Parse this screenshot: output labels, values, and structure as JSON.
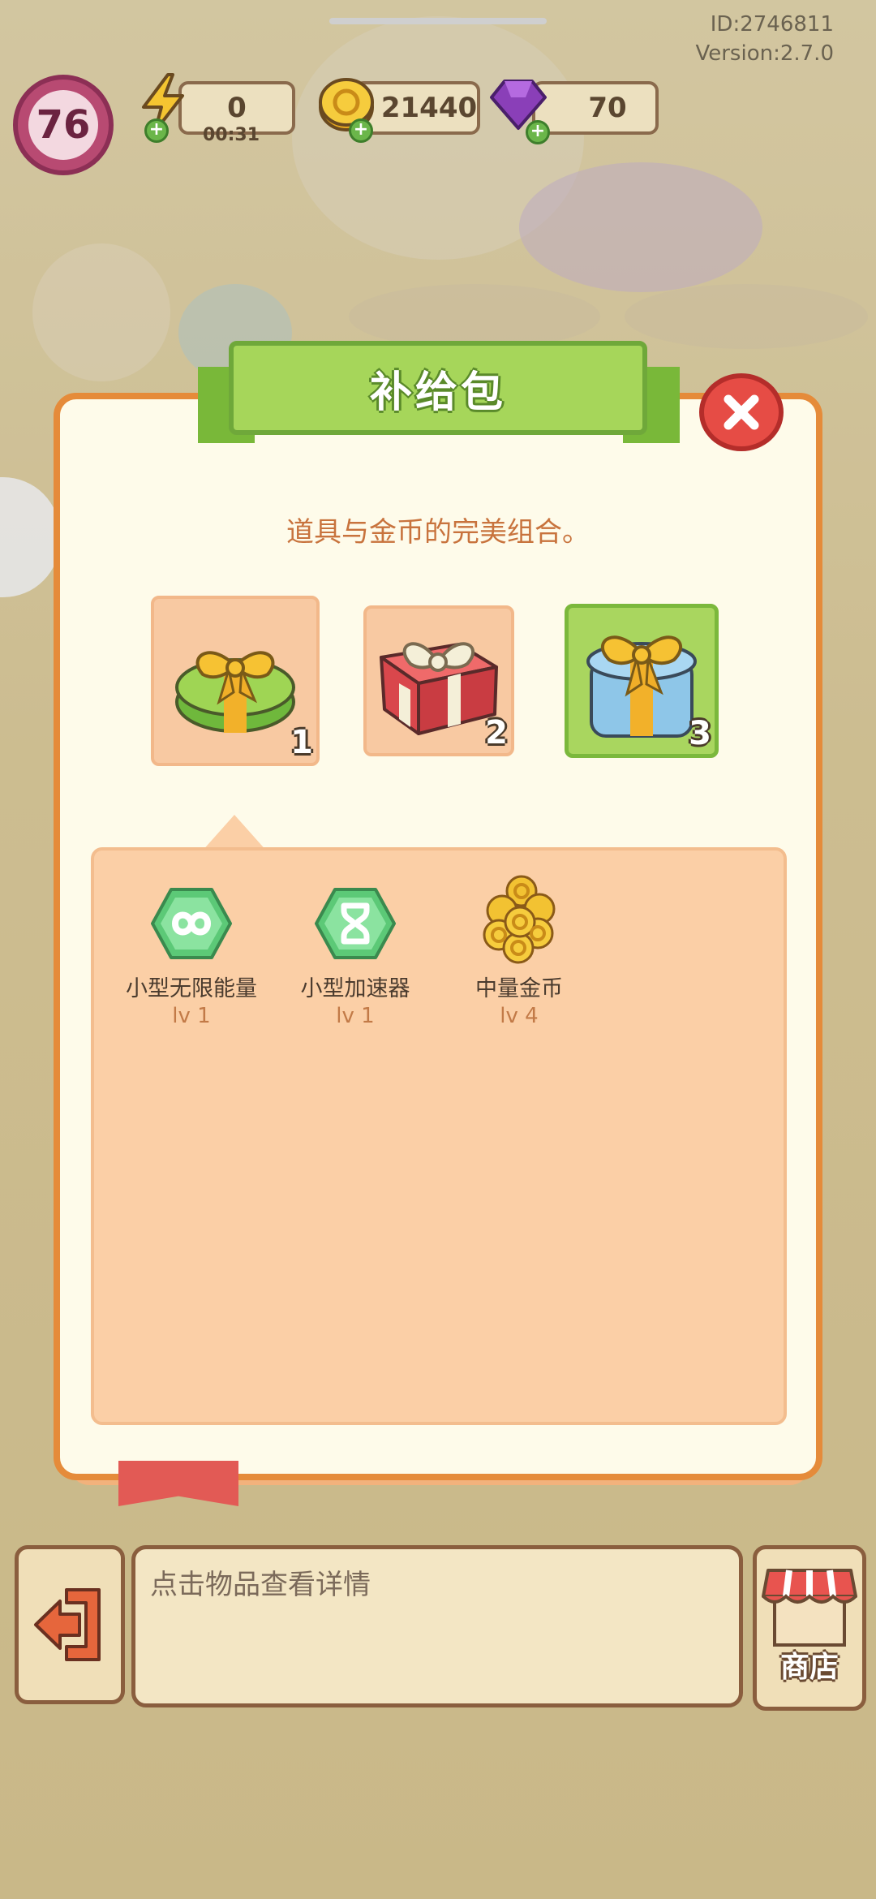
{
  "system": {
    "id_text": "ID:2746811",
    "version_text": "Version:2.7.0"
  },
  "resources": {
    "level": "76",
    "energy": "0",
    "energy_timer": "00:31",
    "coins": "21440",
    "gems": "70"
  },
  "dialog": {
    "title": "补给包",
    "subtitle": "道具与金币的完美组合。",
    "packages": [
      {
        "number": "1",
        "color": "green-gift-icon"
      },
      {
        "number": "2",
        "color": "red-gift-icon"
      },
      {
        "number": "3",
        "color": "blue-gift-icon"
      }
    ],
    "selected_package": "3",
    "rewards": [
      {
        "name": "小型无限能量",
        "level": "lv 1",
        "icon": "infinity-energy-icon"
      },
      {
        "name": "小型加速器",
        "level": "lv 1",
        "icon": "hourglass-icon"
      },
      {
        "name": "中量金币",
        "level": "lv 4",
        "icon": "coin-stack-icon"
      }
    ]
  },
  "bottom_bar": {
    "info_text": "点击物品查看详情",
    "shop_label": "商店"
  },
  "colors": {
    "dialog_border": "#e58b3a",
    "ribbon_green": "#a6d65a",
    "close_red": "#e64c45",
    "panel_peach": "#fbcfa6"
  }
}
